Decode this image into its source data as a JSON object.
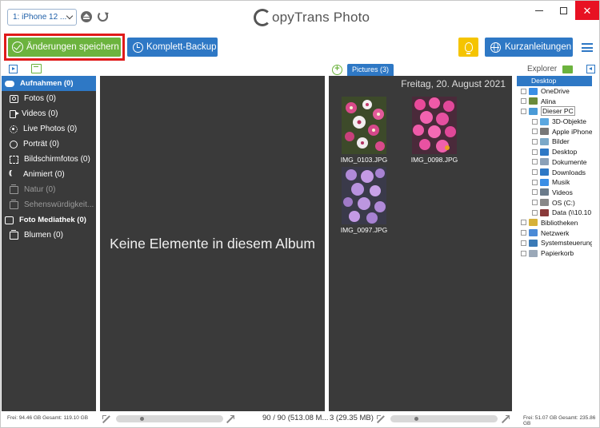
{
  "titlebar": {
    "device_label": "1: iPhone 12 ...",
    "app_title": "opyTrans Photo",
    "close_glyph": "✕"
  },
  "toolbar": {
    "save_label": "Änderungen speichern",
    "backup_label": "Komplett-Backup",
    "guides_label": "Kurzanleitungen"
  },
  "subheader": {
    "pictures_tab": "Pictures (3)",
    "explorer_label": "Explorer"
  },
  "albums": [
    {
      "label": "Aufnahmen (0)",
      "icon": "cloud-icon",
      "header": true,
      "selected": true
    },
    {
      "label": "Fotos (0)",
      "icon": "camera-icon"
    },
    {
      "label": "Videos (0)",
      "icon": "video-icon"
    },
    {
      "label": "Live Photos (0)",
      "icon": "live-photo-icon"
    },
    {
      "label": "Porträt (0)",
      "icon": "portrait-icon"
    },
    {
      "label": "Bildschirmfotos (0)",
      "icon": "screenshot-icon"
    },
    {
      "label": "Animiert (0)",
      "icon": "animated-icon"
    },
    {
      "label": "Natur (0)",
      "icon": "album-icon",
      "dim": true
    },
    {
      "label": "Sehenswürdigkeit...",
      "icon": "album-icon",
      "dim": true
    },
    {
      "label": "Foto Mediathek (0)",
      "icon": "library-icon",
      "header": true
    },
    {
      "label": "Blumen (0)",
      "icon": "album-icon"
    }
  ],
  "center": {
    "empty_message": "Keine Elemente in diesem Album"
  },
  "photos": {
    "date_heading": "Freitag, 20. August 2021",
    "items": [
      {
        "name": "IMG_0103.JPG"
      },
      {
        "name": "IMG_0098.JPG"
      },
      {
        "name": "IMG_0097.JPG"
      }
    ]
  },
  "explorer": {
    "items": [
      {
        "label": "Desktop",
        "indent": 0,
        "color": "#2e78c5",
        "selected": true
      },
      {
        "label": "OneDrive",
        "indent": 1,
        "color": "#3a8ee6"
      },
      {
        "label": "Alina",
        "indent": 1,
        "color": "#6a8a3a"
      },
      {
        "label": "Dieser PC",
        "indent": 1,
        "color": "#4a9ad6",
        "highlight": true
      },
      {
        "label": "3D-Objekte",
        "indent": 2,
        "color": "#5aa7e0"
      },
      {
        "label": "Apple iPhone",
        "indent": 2,
        "color": "#777777"
      },
      {
        "label": "Bilder",
        "indent": 2,
        "color": "#7aa8c8"
      },
      {
        "label": "Desktop",
        "indent": 2,
        "color": "#2e78c5"
      },
      {
        "label": "Dokumente",
        "indent": 2,
        "color": "#8aa0b8"
      },
      {
        "label": "Downloads",
        "indent": 2,
        "color": "#2e78c5"
      },
      {
        "label": "Musik",
        "indent": 2,
        "color": "#3a8ee6"
      },
      {
        "label": "Videos",
        "indent": 2,
        "color": "#6a7a8a"
      },
      {
        "label": "OS (C:)",
        "indent": 2,
        "color": "#888888"
      },
      {
        "label": "Data (\\\\10.10",
        "indent": 2,
        "color": "#8a3a3a"
      },
      {
        "label": "Bibliotheken",
        "indent": 1,
        "color": "#d6b13a"
      },
      {
        "label": "Netzwerk",
        "indent": 1,
        "color": "#4a8ad6"
      },
      {
        "label": "Systemsteuerung",
        "indent": 1,
        "color": "#3a7ab6"
      },
      {
        "label": "Papierkorb",
        "indent": 1,
        "color": "#9aa8b8"
      }
    ]
  },
  "statusbar": {
    "left_free": "Frei: 94.46 GB Gesamt: 119.10 GB",
    "center_count": "90 / 90 (513.08 M...",
    "photos_count": "3 (29.35 MB)",
    "right_free": "Frei: 51.07 GB Gesamt: 235.86 GB"
  },
  "colors": {
    "accent": "#2e78c5",
    "save_green": "#6cb33e",
    "highlight_red": "#e01a1a",
    "panel_dark": "#3a3a3a"
  }
}
